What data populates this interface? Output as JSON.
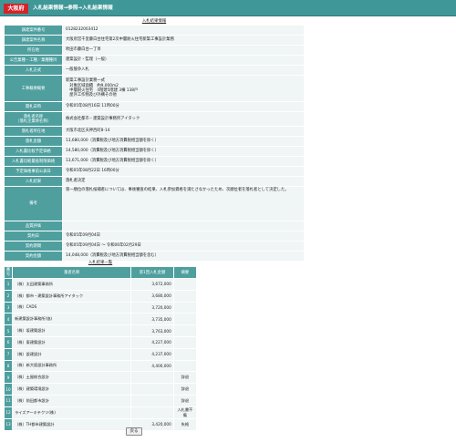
{
  "header": {
    "logo": "大阪府",
    "breadcrumb": "入札結果情報→参照→入札結果情報"
  },
  "detail": {
    "title": "入札結果情報",
    "rows": [
      {
        "label": "調達案件番号",
        "value": "0128232003412"
      },
      {
        "label": "調達案件名称",
        "value": "大阪府営千里藤白台住宅第2次中層耐火住宅新築工事設計業務"
      },
      {
        "label": "所在地",
        "value": "吹田市藤白台一丁目"
      },
      {
        "label": "公告業種・工種／業種種目",
        "value": "建築設計・監理（一般）"
      },
      {
        "label": "入札方式",
        "value": "一般競争入札"
      },
      {
        "label": "工事概要概要",
        "value": "新築工事設計業務一式\n　対象区域面積　約9,000m2\n　中層耐火住宅　4階建5階建 3棟 138戸\n　屋外工作物及び外構その他"
      },
      {
        "label": "開札日時",
        "value": "令和05年08月16日 11時00分"
      },
      {
        "label": "落札者名称\n（落札企業体名称）",
        "value": "株式会社都市・建築設計事務所アイタック"
      },
      {
        "label": "落札者所在地",
        "value": "大阪市北区天神西町8-14"
      },
      {
        "label": "落札金額",
        "value": "13,680,000（消費税及び地方消費税相当額を除く）"
      },
      {
        "label": "入札書比較予定価格",
        "value": "14,580,000（消費税及び地方消費税相当額を除く）"
      },
      {
        "label": "入札書比較最低制限価格",
        "value": "13,671,000（消費税及び地方消費税相当額を除く）"
      },
      {
        "label": "予定価格事前公表日",
        "value": "令和05年08月22日 16時00分"
      },
      {
        "label": "入札結果",
        "value": "落札者決定"
      },
      {
        "label": "備考",
        "value": "第一順位の落札候補者については、事後審査の結果、入札参加資格を満たさなかったため、次順位者を落札者として決定した。"
      },
      {
        "label": "品質評価",
        "value": ""
      },
      {
        "label": "契約日",
        "value": "令和05年09月04日"
      },
      {
        "label": "契約期間",
        "value": "令和05年09月04日 ～ 令和06年02月29日"
      },
      {
        "label": "契約金額",
        "value": "14,048,000（消費税及び地方消費税相当額を含む）"
      }
    ]
  },
  "bids": {
    "title": "入札結果一覧",
    "headers": {
      "no": "番号",
      "name": "業者名称",
      "amount": "第1回入札金額",
      "note": "摘要"
    },
    "rows": [
      {
        "no": "1",
        "name": "（株）太田建築事務所",
        "amount": "3,672,000",
        "note": ""
      },
      {
        "no": "2",
        "name": "（株）都市・建築設計事務所アイタック",
        "amount": "3,680,000",
        "note": ""
      },
      {
        "no": "3",
        "name": "（株）CADS",
        "amount": "3,720,000",
        "note": ""
      },
      {
        "no": "4",
        "name": "新建築設計事務所(協)",
        "amount": "3,735,000",
        "note": ""
      },
      {
        "no": "5",
        "name": "（株）坂建築設計",
        "amount": "3,763,000",
        "note": ""
      },
      {
        "no": "6",
        "name": "（株）東建築設計",
        "amount": "4,227,000",
        "note": ""
      },
      {
        "no": "7",
        "name": "（株）設建設計",
        "amount": "4,237,000",
        "note": ""
      },
      {
        "no": "8",
        "name": "（株）新大阪設計事務所",
        "amount": "4,400,000",
        "note": ""
      },
      {
        "no": "9",
        "name": "（株）土屋総合設計",
        "amount": "",
        "note": "辞退"
      },
      {
        "no": "10",
        "name": "（株）建築環境設計",
        "amount": "",
        "note": "辞退"
      },
      {
        "no": "11",
        "name": "（株）前田都市設計",
        "amount": "",
        "note": "辞退"
      },
      {
        "no": "12",
        "name": "ライズアーキテクツ(株)",
        "amount": "",
        "note": "入札書不備"
      },
      {
        "no": "13",
        "name": "（株）TH都市建築設計",
        "amount": "3,420,000",
        "note": "失格"
      }
    ]
  },
  "back_label": "戻る",
  "colors": {
    "header": "#3f9797",
    "logo": "#d5232a",
    "label_cell": "#4f9f9f",
    "value_cell": "#f0f5f5"
  }
}
